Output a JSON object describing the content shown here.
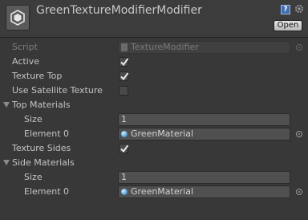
{
  "header": {
    "title": "GreenTextureModifierModifier",
    "open_label": "Open",
    "help_icon": "?",
    "script_icon": "unity-script-icon"
  },
  "fields": {
    "script": {
      "label": "Script",
      "value": "TextureModifier"
    },
    "active": {
      "label": "Active",
      "checked": true
    },
    "texture_top": {
      "label": "Texture Top",
      "checked": true
    },
    "use_satellite": {
      "label": "Use Satellite Texture",
      "checked": false
    },
    "top_materials": {
      "label": "Top Materials",
      "size_label": "Size",
      "size": "1",
      "element_label": "Element 0",
      "element_value": "GreenMaterial"
    },
    "texture_sides": {
      "label": "Texture Sides",
      "checked": true
    },
    "side_materials": {
      "label": "Side Materials",
      "size_label": "Size",
      "size": "1",
      "element_label": "Element 0",
      "element_value": "GreenMaterial"
    }
  },
  "colors": {
    "background": "#383838",
    "header": "#3c3c3c",
    "field": "#505050",
    "material_icon": "#5aa6dd"
  }
}
